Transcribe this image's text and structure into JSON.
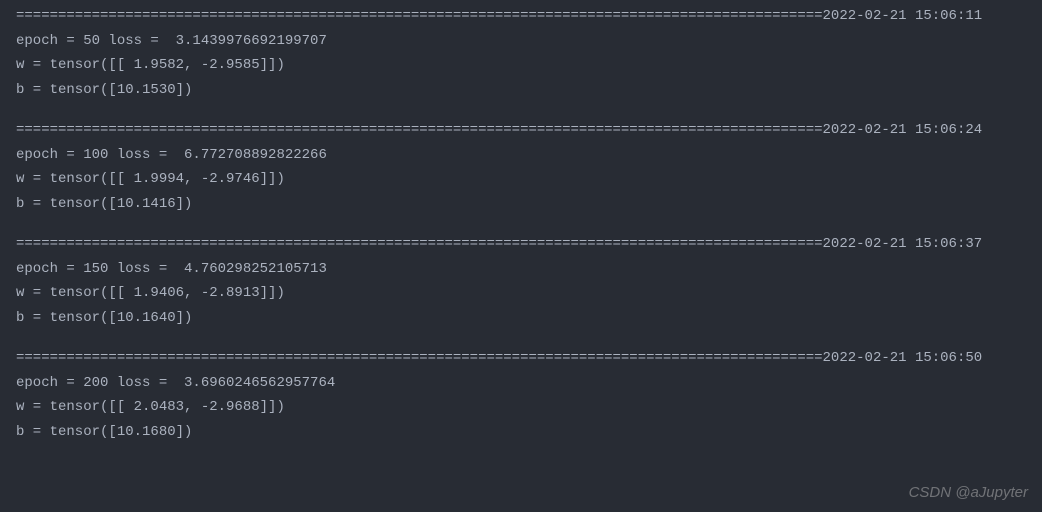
{
  "separator_char": "=",
  "blocks": [
    {
      "timestamp": "2022-02-21 15:06:11",
      "lines": [
        "epoch = 50 loss =  3.1439976692199707",
        "w = tensor([[ 1.9582, -2.9585]])",
        "b = tensor([10.1530])"
      ]
    },
    {
      "timestamp": "2022-02-21 15:06:24",
      "lines": [
        "epoch = 100 loss =  6.772708892822266",
        "w = tensor([[ 1.9994, -2.9746]])",
        "b = tensor([10.1416])"
      ]
    },
    {
      "timestamp": "2022-02-21 15:06:37",
      "lines": [
        "epoch = 150 loss =  4.760298252105713",
        "w = tensor([[ 1.9406, -2.8913]])",
        "b = tensor([10.1640])"
      ]
    },
    {
      "timestamp": "2022-02-21 15:06:50",
      "lines": [
        "epoch = 200 loss =  3.6960246562957764",
        "w = tensor([[ 2.0483, -2.9688]])",
        "b = tensor([10.1680])"
      ]
    }
  ],
  "watermark": "CSDN @aJupyter"
}
